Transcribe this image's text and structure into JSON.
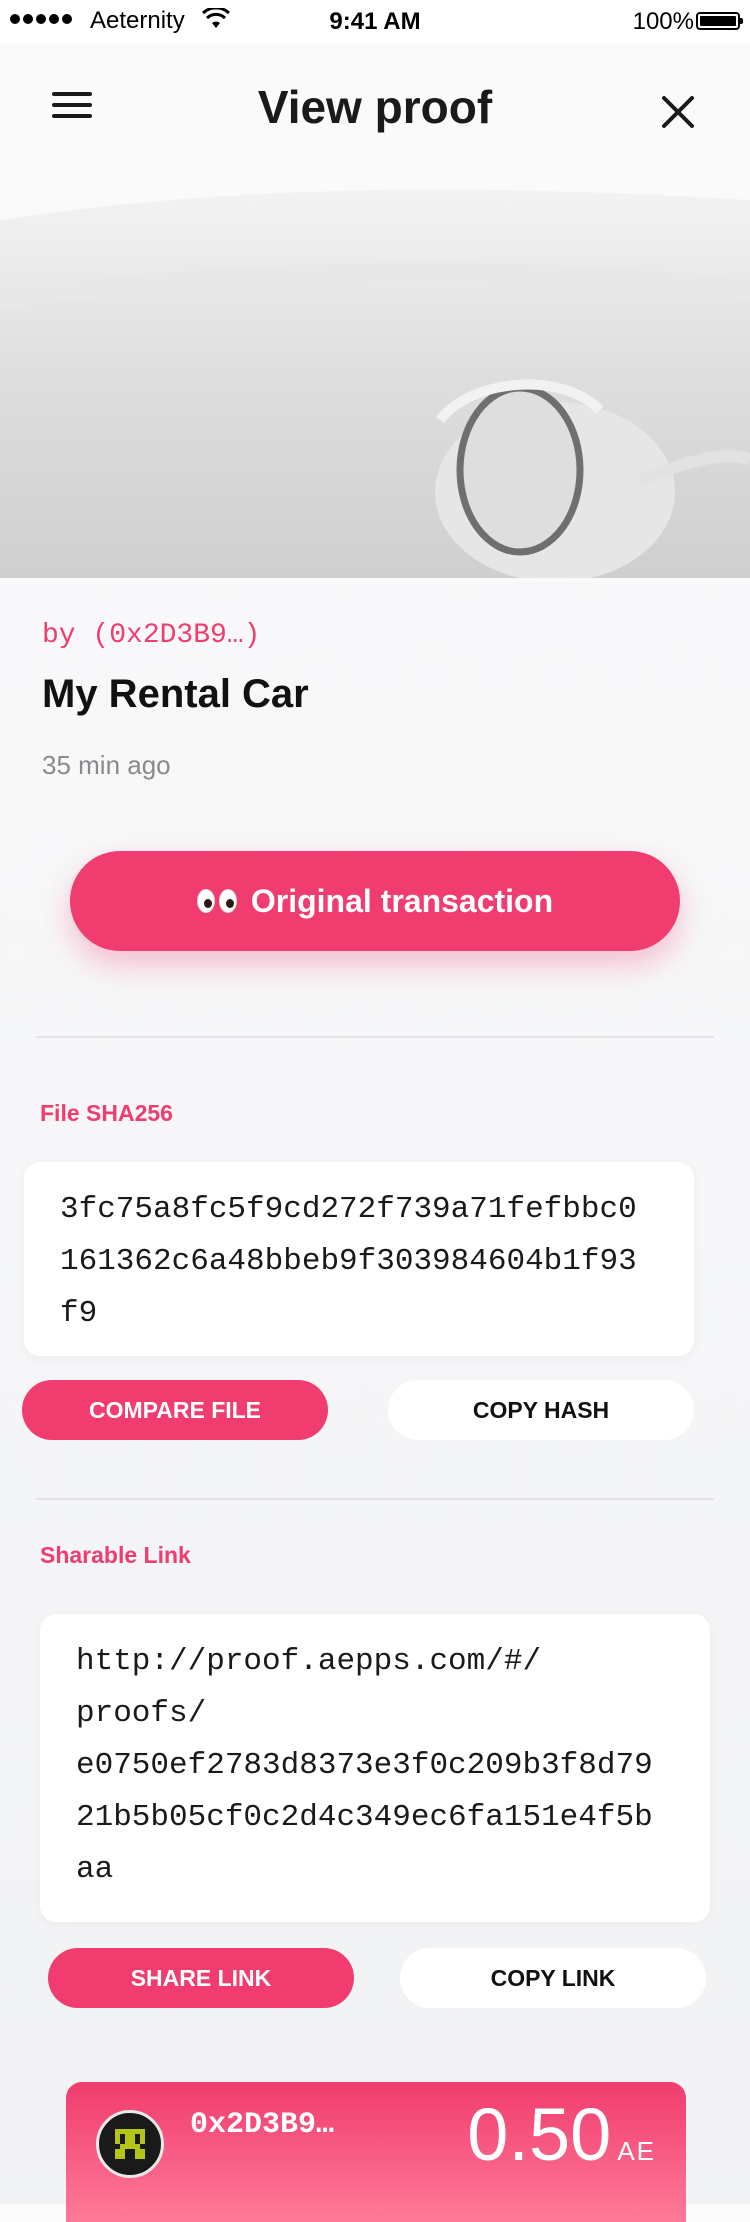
{
  "status_bar": {
    "carrier": "Aeternity",
    "time": "9:41 AM",
    "battery": "100%"
  },
  "header": {
    "title": "View proof"
  },
  "proof": {
    "author": "by (0x2D3B9…)",
    "title": "My Rental Car",
    "time_ago": "35 min ago",
    "original_transaction_label": "Original transaction"
  },
  "hash_section": {
    "label": "File SHA256",
    "hash_lines": [
      "3fc75a8fc5f9cd272f739a71fefbbc0",
      "161362c6a48bbeb9f303984604b1f93",
      "f9"
    ],
    "compare_label": "COMPARE FILE",
    "copy_label": "COPY HASH"
  },
  "link_section": {
    "label": "Sharable Link",
    "link_lines": [
      "http://proof.aepps.com/#/",
      "proofs/",
      "e0750ef2783d8373e3f0c209b3f8d79",
      "21b5b05cf0c2d4c349ec6fa151e4f5b",
      "aa"
    ],
    "share_label": "SHARE LINK",
    "copy_label": "COPY LINK"
  },
  "account": {
    "address": "0x2D3B9…",
    "balance": "0.50",
    "unit": "AE"
  },
  "colors": {
    "accent": "#f03c6e",
    "background": "#f5f6f8"
  }
}
